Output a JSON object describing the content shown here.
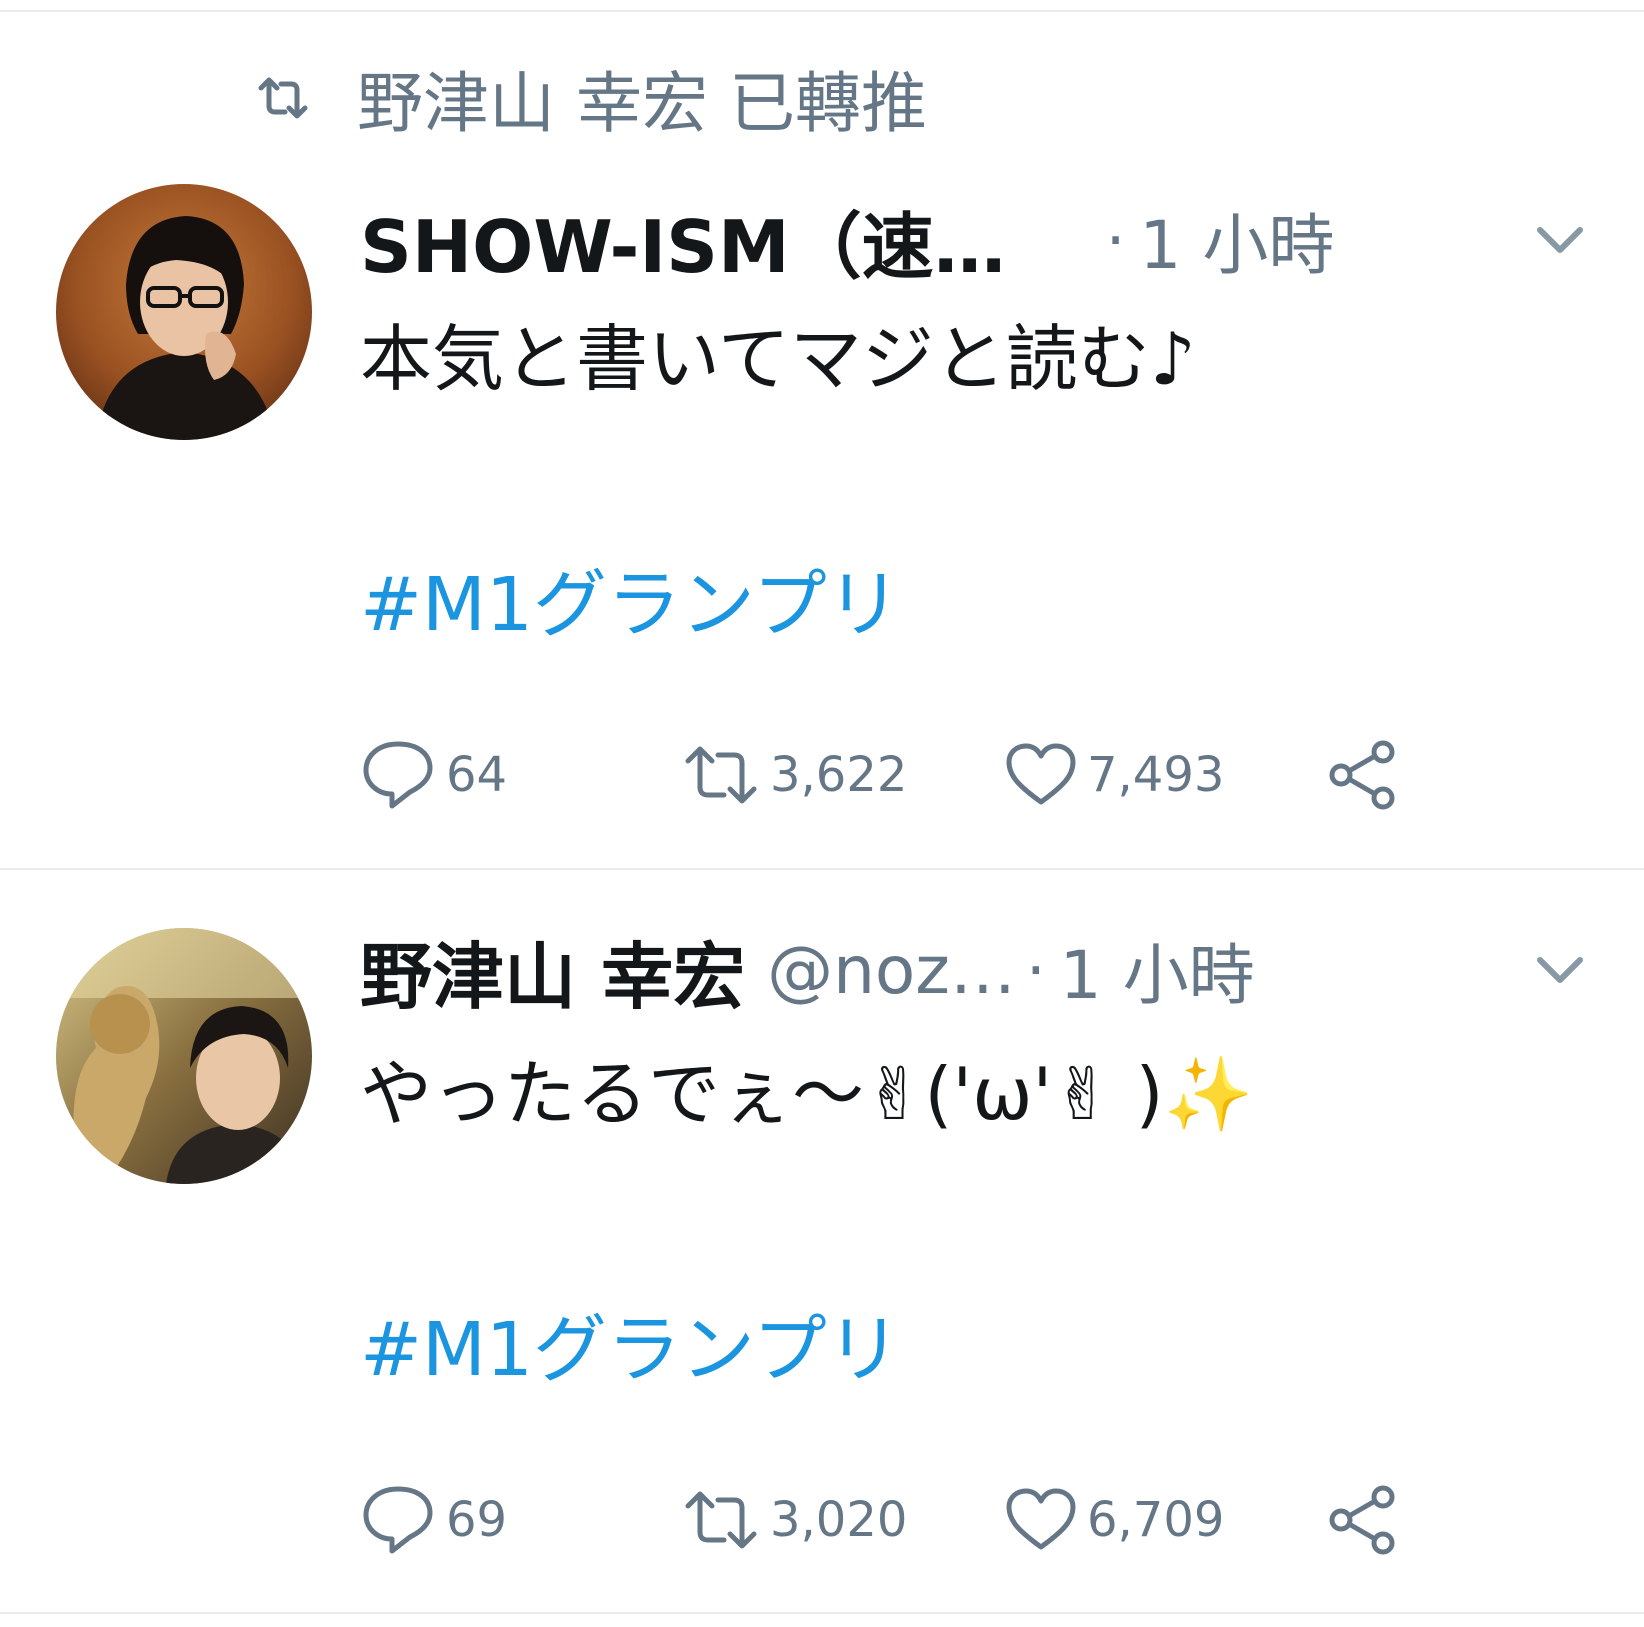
{
  "colors": {
    "text": "#14171a",
    "muted": "#657786",
    "link": "#1b95e0",
    "divider": "#e6ecf0"
  },
  "retweet_context": {
    "icon": "retweet-icon",
    "label": "野津山 幸宏 已轉推"
  },
  "tweets": [
    {
      "display_name": "SHOW-ISM（速…",
      "handle": "",
      "separator": "·",
      "time": "1 小時",
      "text": "本気と書いてマジと読む♪",
      "hashtag": "#M1グランプリ",
      "replies": "64",
      "retweets": "3,622",
      "likes": "7,493"
    },
    {
      "display_name": "野津山 幸宏",
      "handle": "@noz…",
      "separator": "·",
      "time": "1 小時",
      "text": "やったるでぇ〜✌('ω'✌ )✨",
      "hashtag": "#M1グランプリ",
      "replies": "69",
      "retweets": "3,020",
      "likes": "6,709"
    }
  ]
}
